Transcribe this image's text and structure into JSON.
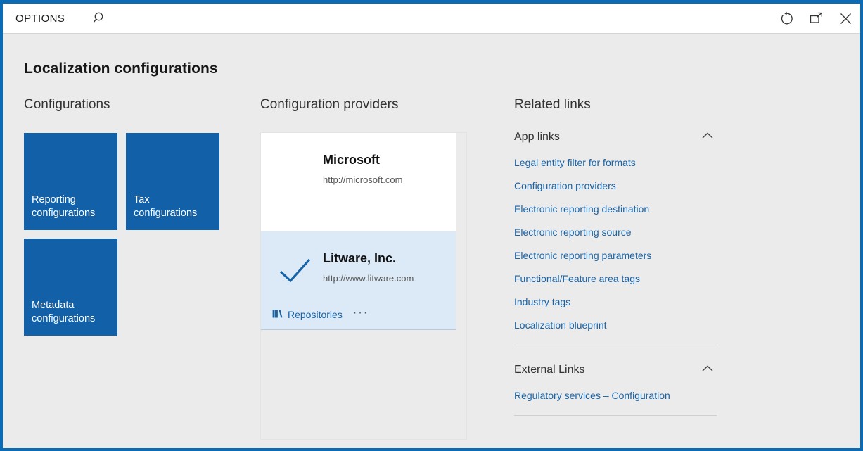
{
  "window": {
    "accent_color": "#0b6bb5",
    "tile_color": "#1160a8",
    "link_color": "#1763a8",
    "selected_card_color": "#dce9f7"
  },
  "command_bar": {
    "options_label": "OPTIONS",
    "search_icon": "search-icon",
    "controls": [
      {
        "name": "refresh-button",
        "icon": "refresh-icon"
      },
      {
        "name": "popout-button",
        "icon": "popout-icon"
      },
      {
        "name": "close-button",
        "icon": "close-icon"
      }
    ]
  },
  "page": {
    "title": "Localization configurations"
  },
  "configurations": {
    "heading": "Configurations",
    "tiles": [
      {
        "label": "Reporting\nconfigurations"
      },
      {
        "label": "Tax\nconfigurations"
      },
      {
        "label": "Metadata\nconfigurations"
      }
    ]
  },
  "providers": {
    "heading": "Configuration providers",
    "items": [
      {
        "name": "Microsoft",
        "url": "http://microsoft.com",
        "selected": false
      },
      {
        "name": "Litware, Inc.",
        "url": "http://www.litware.com",
        "selected": true,
        "repositories_label": "Repositories",
        "overflow_label": "···"
      }
    ]
  },
  "related_links": {
    "heading": "Related links",
    "groups": [
      {
        "title": "App links",
        "expanded": true,
        "links": [
          "Legal entity filter for formats",
          "Configuration providers",
          "Electronic reporting destination",
          "Electronic reporting source",
          "Electronic reporting parameters",
          "Functional/Feature area tags",
          "Industry tags",
          "Localization blueprint"
        ]
      },
      {
        "title": "External Links",
        "expanded": true,
        "links": [
          "Regulatory services – Configuration"
        ]
      }
    ]
  }
}
